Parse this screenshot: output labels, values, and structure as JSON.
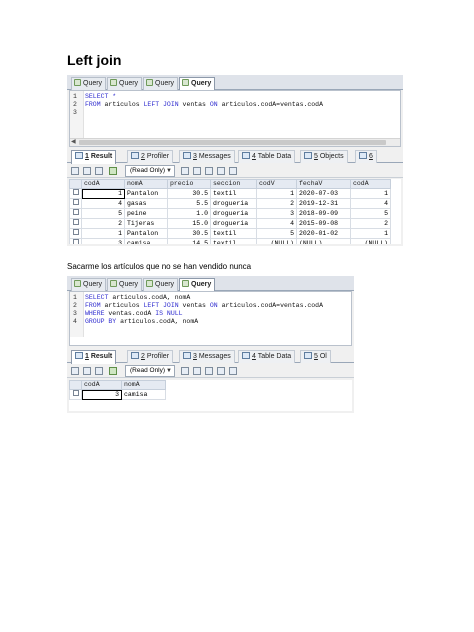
{
  "document": {
    "heading": "Left join",
    "caption": "Sacarme los artículos que no se han vendido nunca"
  },
  "editor_tabs": [
    "Query",
    "Query",
    "Query",
    "Query"
  ],
  "result_tabs": [
    {
      "num": "1",
      "label": "Result"
    },
    {
      "num": "2",
      "label": "Profiler"
    },
    {
      "num": "3",
      "label": "Messages"
    },
    {
      "num": "4",
      "label": "Table Data"
    },
    {
      "num": "5",
      "label": "Objects"
    },
    {
      "num": "6",
      "label": ""
    }
  ],
  "result_tabs_2": [
    {
      "num": "1",
      "label": "Result"
    },
    {
      "num": "2",
      "label": "Profiler"
    },
    {
      "num": "3",
      "label": "Messages"
    },
    {
      "num": "4",
      "label": "Table Data"
    },
    {
      "num": "5",
      "label": "Ol"
    }
  ],
  "toolbar": {
    "readonly_label": "(Read Only)"
  },
  "query1": {
    "lines": [
      {
        "n": "1",
        "parts": [
          {
            "t": "SELECT *",
            "k": true
          }
        ]
      },
      {
        "n": "2",
        "parts": [
          {
            "t": "FROM ",
            "k": true
          },
          {
            "t": "articulos ",
            "k": false
          },
          {
            "t": "LEFT JOIN ",
            "k": true
          },
          {
            "t": "ventas ",
            "k": false
          },
          {
            "t": "ON ",
            "k": true
          },
          {
            "t": "articulos.codA=ventas.codA",
            "k": false
          }
        ]
      },
      {
        "n": "3",
        "parts": []
      }
    ],
    "columns": [
      "codA",
      "nomA",
      "precio",
      "seccion",
      "codV",
      "fechaV",
      "codA"
    ],
    "rows": [
      [
        "1",
        "Pantalon",
        "30.5",
        "textil",
        "1",
        "2020-07-03",
        "1"
      ],
      [
        "4",
        "gasas",
        "5.5",
        "drogueria",
        "2",
        "2019-12-31",
        "4"
      ],
      [
        "5",
        "peine",
        "1.0",
        "drogueria",
        "3",
        "2018-09-09",
        "5"
      ],
      [
        "2",
        "Tijeras",
        "15.0",
        "drogueria",
        "4",
        "2015-09-08",
        "2"
      ],
      [
        "1",
        "Pantalon",
        "30.5",
        "textil",
        "5",
        "2020-01-02",
        "1"
      ],
      [
        "3",
        "camisa",
        "14.5",
        "textil",
        "(NULL)",
        "(NULL)",
        "(NULL)"
      ]
    ]
  },
  "query2": {
    "lines": [
      {
        "n": "1",
        "parts": [
          {
            "t": "SELECT ",
            "k": true
          },
          {
            "t": "articulos.codA, nomA",
            "k": false
          }
        ]
      },
      {
        "n": "2",
        "parts": [
          {
            "t": "FROM ",
            "k": true
          },
          {
            "t": "articulos ",
            "k": false
          },
          {
            "t": "LEFT JOIN ",
            "k": true
          },
          {
            "t": "ventas ",
            "k": false
          },
          {
            "t": "ON ",
            "k": true
          },
          {
            "t": "articulos.codA=ventas.codA",
            "k": false
          }
        ]
      },
      {
        "n": "3",
        "parts": [
          {
            "t": "WHERE ",
            "k": true
          },
          {
            "t": "ventas.codA ",
            "k": false
          },
          {
            "t": "IS NULL",
            "k": true
          }
        ]
      },
      {
        "n": "4",
        "parts": [
          {
            "t": "GROUP BY ",
            "k": true
          },
          {
            "t": "articulos.codA, nomA",
            "k": false
          }
        ]
      }
    ],
    "columns": [
      "codA",
      "nomA"
    ],
    "rows": [
      [
        "3",
        "camisa"
      ]
    ]
  }
}
